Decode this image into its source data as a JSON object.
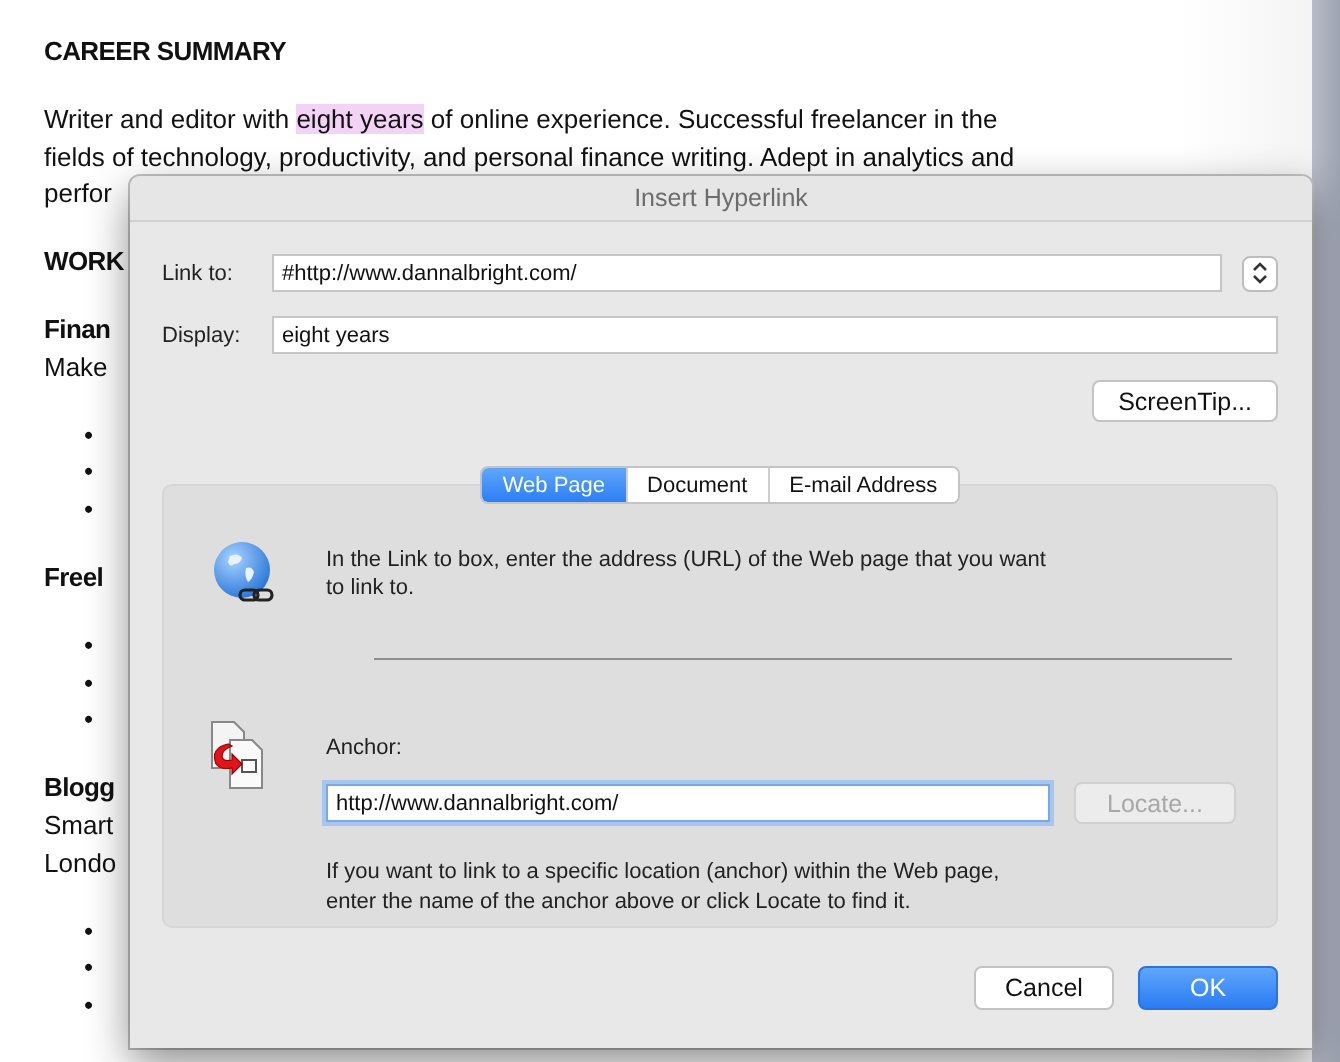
{
  "document": {
    "blocks": [
      {
        "kind": "heading",
        "text": "CAREER SUMMARY"
      },
      {
        "kind": "paragraph",
        "lines": [
          [
            {
              "text": "Writer and editor with ",
              "highlighted": false
            },
            {
              "text": "eight years",
              "highlighted": true
            },
            {
              "text": " of online experience. Successful freelancer in the",
              "highlighted": false
            }
          ],
          [
            {
              "text": "fields of technology, productivity, and personal finance writing. Adept in analytics and",
              "highlighted": false
            }
          ],
          [
            {
              "text": "perfor",
              "highlighted": false
            }
          ]
        ]
      },
      {
        "kind": "heading",
        "text": "WORK"
      },
      {
        "kind": "heading",
        "text": "Finan"
      },
      {
        "kind": "line",
        "text": "Make"
      },
      {
        "kind": "bullets",
        "items": [
          "•",
          "•",
          "•"
        ]
      },
      {
        "kind": "heading",
        "text": "Freel"
      },
      {
        "kind": "bullets",
        "items": [
          "•",
          "•",
          "•"
        ]
      },
      {
        "kind": "heading",
        "text": "Blogg"
      },
      {
        "kind": "line",
        "text": "Smart"
      },
      {
        "kind": "line",
        "text": "Londo"
      },
      {
        "kind": "bullets",
        "items": [
          "•",
          "•",
          "•"
        ]
      }
    ]
  },
  "dialog": {
    "title": "Insert Hyperlink",
    "link_to": {
      "label": "Link to:",
      "value": "#http://www.dannalbright.com/"
    },
    "display": {
      "label": "Display:",
      "value": "eight years"
    },
    "screentip_button": "ScreenTip...",
    "tabs": [
      {
        "label": "Web Page",
        "selected": true
      },
      {
        "label": "Document",
        "selected": false
      },
      {
        "label": "E-mail Address",
        "selected": false
      }
    ],
    "info": "In the Link to box, enter the address (URL) of the Web page that you want to link to.",
    "anchor": {
      "label": "Anchor:",
      "value": "http://www.dannalbright.com/",
      "focused": true
    },
    "locate_button": {
      "label": "Locate...",
      "disabled": true
    },
    "anchor_help": "If you want to link to a specific location (anchor) within the Web page, enter the name of the anchor above or click Locate to find it.",
    "buttons": [
      {
        "label": "Cancel",
        "kind": "normal"
      },
      {
        "label": "OK",
        "kind": "default"
      }
    ]
  }
}
